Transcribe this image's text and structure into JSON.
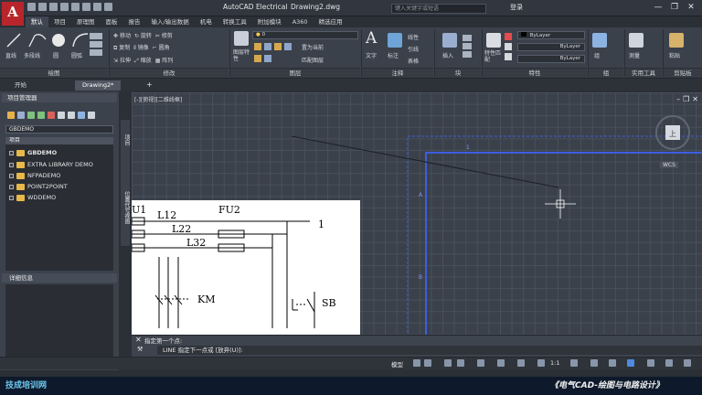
{
  "window": {
    "app_title": "AutoCAD Electrical",
    "doc_name": "Drawing2.dwg",
    "search_placeholder": "键入关键字或短语",
    "login": "登录",
    "controls": [
      "—",
      "❐",
      "✕"
    ]
  },
  "ribbon_tabs": [
    "默认",
    "项目",
    "原理图",
    "面板",
    "报告",
    "输入/输出数据",
    "机电",
    "转换工具",
    "附加模块",
    "A360",
    "精选应用"
  ],
  "ribbon": {
    "draw": {
      "line": "直线",
      "polyline": "多段线",
      "circle": "圆",
      "arc": "圆弧",
      "label": "绘图"
    },
    "modify": {
      "move": "移动",
      "rotate": "旋转",
      "trim": "修剪",
      "copy": "复制",
      "mirror": "镜像",
      "fillet": "圆角",
      "stretch": "拉伸",
      "scale": "缩放",
      "array": "阵列",
      "label": "修改"
    },
    "layers": {
      "layer_props": "图层特性",
      "layer_name": "0",
      "make_current": "置为当前",
      "match_layer": "匹配图层",
      "label": "图层"
    },
    "annotation": {
      "text": "文字",
      "dimension": "标注",
      "linear": "线性",
      "leader": "引线",
      "table": "表格",
      "label": "注释"
    },
    "block": {
      "insert": "插入",
      "label": "块"
    },
    "properties": {
      "match": "特性匹配",
      "color": "ByLayer",
      "linetype": "ByLayer",
      "lineweight": "ByLayer",
      "label": "特性"
    },
    "groups": {
      "group": "组",
      "label": "组"
    },
    "utilities": {
      "measure": "测量",
      "label": "实用工具"
    },
    "clipboard": {
      "paste": "粘贴",
      "label": "剪贴板"
    }
  },
  "file_tabs": [
    "开始",
    "Drawing2*"
  ],
  "project_manager": {
    "title": "项目管理器",
    "combo_value": "GBDEMO",
    "tree_header": "项目",
    "projects": [
      "GBDEMO",
      "EXTRA LIBRARY DEMO",
      "NFPADEMO",
      "POINT2POINT",
      "WDDEMO"
    ],
    "details_title": "详细信息",
    "side_tab_top": "项目",
    "side_tab_bottom": "位置代号视图"
  },
  "viewport": {
    "label": "[-][俯视][二维线框]",
    "wcs": "WCS",
    "compass_letter": "上"
  },
  "schematic": {
    "labels": {
      "u1": "U1",
      "l12": "L12",
      "l22": "L22",
      "l32": "L32",
      "fu2": "FU2",
      "one": "1",
      "km": "KM",
      "sb": "SB"
    },
    "sheet_numbers": {
      "top": "1",
      "left_a": "A",
      "left_b": "B"
    }
  },
  "command_line": {
    "history": "指定第一个点:",
    "prompt": "LINE 指定下一点或 [放弃(U)]:"
  },
  "status_bar": {
    "model": "模型",
    "scale": "1:1"
  },
  "banner": {
    "left": "技成培训网",
    "right": "《电气CAD-绘图与电路设计》"
  },
  "colors": {
    "accent_blue": "#3c5ee0",
    "folder_yellow": "#e8b84a",
    "app_red": "#b8262b"
  }
}
